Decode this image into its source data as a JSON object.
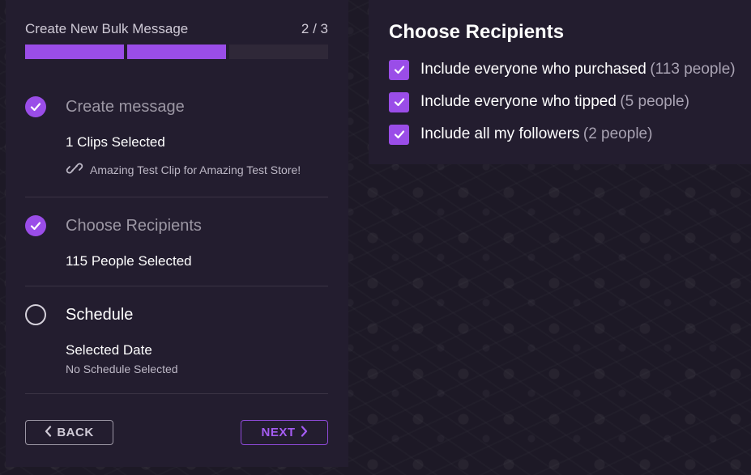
{
  "wizard": {
    "title": "Create New Bulk Message",
    "step_counter": "2 / 3",
    "progress": {
      "total_segments": 3,
      "completed_segments": 2
    }
  },
  "steps": [
    {
      "title": "Create message",
      "status": "complete",
      "summary": "1 Clips Selected",
      "link_text": "Amazing Test Clip for Amazing Test Store!",
      "link_icon": "link-icon"
    },
    {
      "title": "Choose Recipients",
      "status": "complete",
      "summary": "115 People Selected"
    },
    {
      "title": "Schedule",
      "status": "current",
      "summary": "Selected Date",
      "detail": "No Schedule Selected"
    }
  ],
  "buttons": {
    "back_label": "BACK",
    "next_label": "NEXT"
  },
  "recipients_panel": {
    "title": "Choose Recipients",
    "options": [
      {
        "label": "Include everyone who purchased",
        "count": "(113 people)",
        "checked": true
      },
      {
        "label": "Include everyone who tipped",
        "count": "(5 people)",
        "checked": true
      },
      {
        "label": "Include all my followers",
        "count": "(2 people)",
        "checked": true
      }
    ]
  },
  "colors": {
    "accent": "#9a4de8",
    "panel_bg": "#231d2f",
    "page_bg": "#1d1926"
  }
}
